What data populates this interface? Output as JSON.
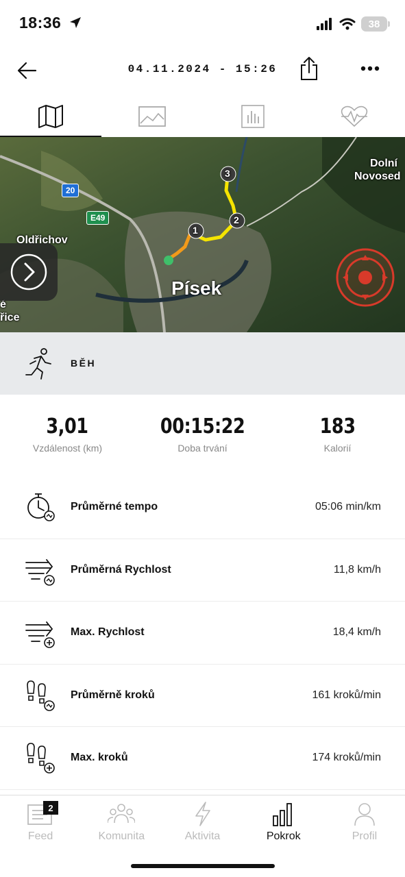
{
  "status_bar": {
    "time": "18:36",
    "battery": "38"
  },
  "header": {
    "title": "04.11.2024 - 15:26"
  },
  "tabs": [
    {
      "name": "map",
      "icon": "map-icon"
    },
    {
      "name": "photos",
      "icon": "image-icon"
    },
    {
      "name": "charts",
      "icon": "bar-chart-icon"
    },
    {
      "name": "heart",
      "icon": "heart-rate-icon"
    }
  ],
  "map": {
    "city": "Písek",
    "labels": {
      "oldrichov": "Oldřichov",
      "dolni": "Dolní",
      "novosedly": "Novosed",
      "rice": "řice",
      "e": "é"
    },
    "road_signs": {
      "a": "20",
      "b": "E49"
    },
    "markers": [
      "1",
      "2",
      "3"
    ],
    "colors": {
      "route_yellow": "#f5e400",
      "route_orange": "#f29a1a",
      "start": "#3fbf6a",
      "locate": "#d83a2a"
    }
  },
  "activity": {
    "label": "BĚH"
  },
  "summary": [
    {
      "value": "3,01",
      "label": "Vzdálenost (km)"
    },
    {
      "value": "00:15:22",
      "label": "Doba trvání"
    },
    {
      "value": "183",
      "label": "Kalorií"
    }
  ],
  "metrics": [
    {
      "label": "Průměrné tempo",
      "value": "05:06 min/km",
      "icon": "stopwatch-icon"
    },
    {
      "label": "Průměrná Rychlost",
      "value": "11,8 km/h",
      "icon": "speed-avg-icon"
    },
    {
      "label": "Max. Rychlost",
      "value": "18,4 km/h",
      "icon": "speed-max-icon"
    },
    {
      "label": "Průměrně kroků",
      "value": "161 kroků/min",
      "icon": "steps-avg-icon"
    },
    {
      "label": "Max. kroků",
      "value": "174 kroků/min",
      "icon": "steps-max-icon"
    }
  ],
  "bottom_nav": {
    "feed": {
      "label": "Feed",
      "badge": "2"
    },
    "komunita": {
      "label": "Komunita"
    },
    "aktivita": {
      "label": "Aktivita"
    },
    "pokrok": {
      "label": "Pokrok"
    },
    "profil": {
      "label": "Profil"
    }
  }
}
